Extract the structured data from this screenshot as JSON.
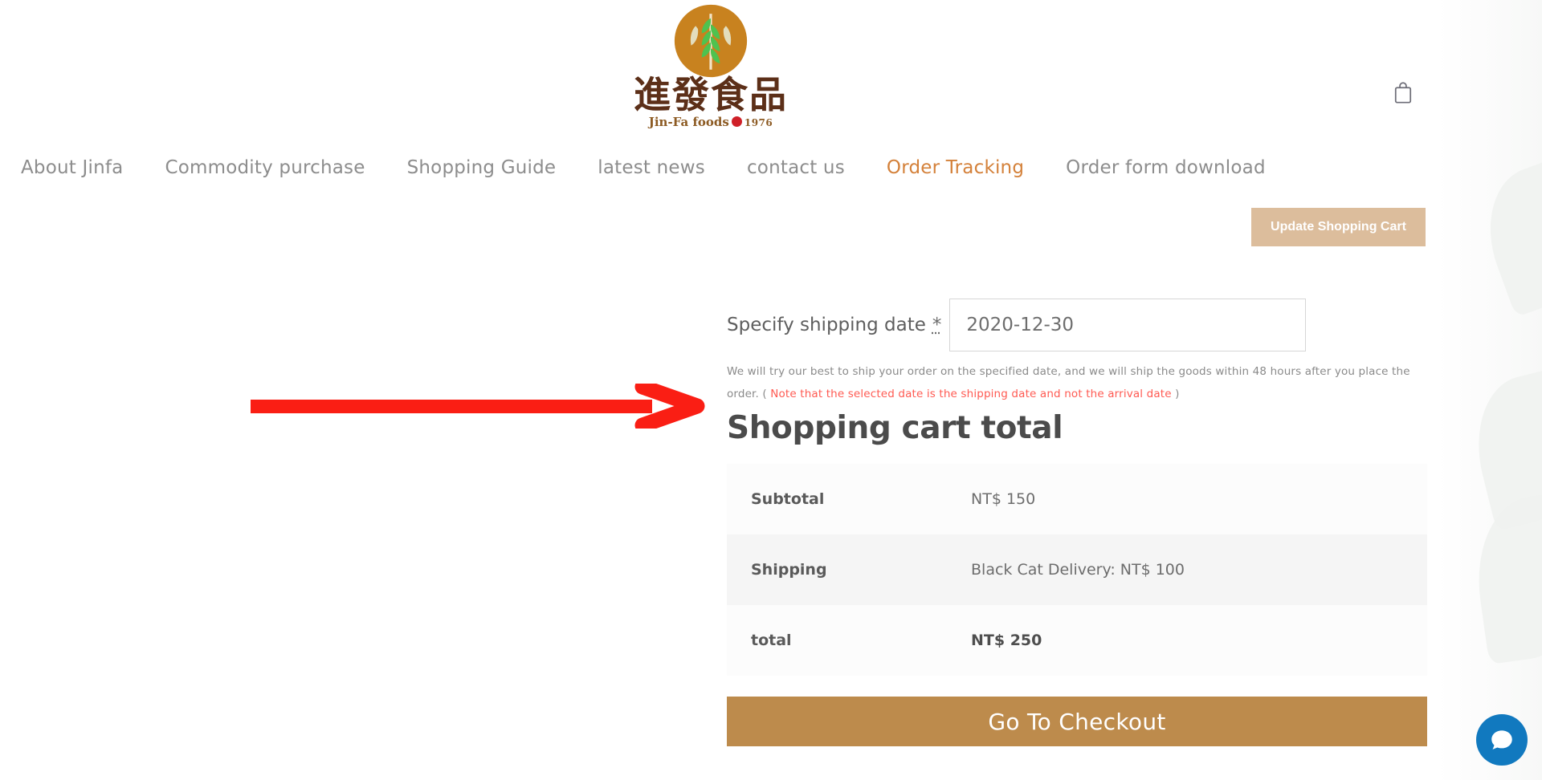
{
  "header": {
    "logo": {
      "name_cn": "進發食品",
      "name_en": "Jin-Fa foods",
      "year": "1976",
      "mark_icon": "wheat-circle-icon"
    },
    "cart_icon": "shopping-bag-icon"
  },
  "nav": {
    "items": [
      {
        "label": "About Jinfa",
        "active": false
      },
      {
        "label": "Commodity purchase",
        "active": false
      },
      {
        "label": "Shopping Guide",
        "active": false
      },
      {
        "label": "latest news",
        "active": false
      },
      {
        "label": "contact us",
        "active": false
      },
      {
        "label": "Order Tracking",
        "active": true
      },
      {
        "label": "Order form download",
        "active": false
      }
    ],
    "active_color": "#d4813a",
    "idle_color": "#8d8d8d"
  },
  "toolbar": {
    "update_cart_label": "Update Shopping Cart",
    "update_cart_color": "#dcbd9c"
  },
  "shipping_date": {
    "label": "Specify shipping date",
    "required_mark": "*",
    "value": "2020-12-30",
    "placeholder": "YYYY-MM-DD",
    "note_part1": "We will try our best to ship your order on the specified date, and we will ship the goods within 48 hours after you place the order. ( ",
    "note_warning": "Note that the selected date is the shipping date and not the arrival date",
    "note_part2": " )",
    "warning_color": "#ff5a52"
  },
  "cart_totals": {
    "title": "Shopping cart total",
    "rows": [
      {
        "label": "Subtotal",
        "value": "NT$ 150",
        "strong": false,
        "shaded": false
      },
      {
        "label": "Shipping",
        "value": "Black Cat Delivery: NT$ 100",
        "strong": false,
        "shaded": true
      },
      {
        "label": "total",
        "value": "NT$ 250",
        "strong": true,
        "shaded": false
      }
    ],
    "checkout_label": "Go To Checkout",
    "checkout_color": "#bd8b4c"
  },
  "annotation": {
    "arrow_color": "#fa1e14",
    "arrow_direction": "right"
  },
  "chat": {
    "icon": "chat-bubble-icon",
    "color": "#1179bf"
  }
}
